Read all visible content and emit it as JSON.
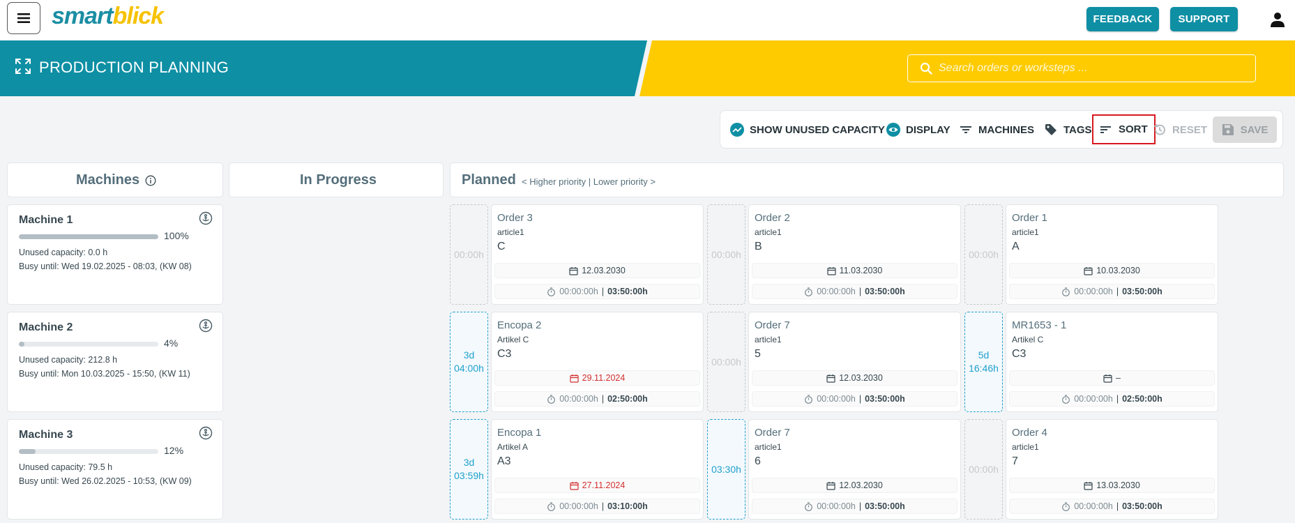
{
  "brand": {
    "logo_part1": "smart",
    "logo_part2": "blick"
  },
  "topnav": {
    "feedback": "FEEDBACK",
    "support": "SUPPORT"
  },
  "banner": {
    "title": "PRODUCTION PLANNING",
    "search_placeholder": "Search orders or worksteps ..."
  },
  "toolbar": {
    "unused": "SHOW UNUSED CAPACITY",
    "display": "DISPLAY",
    "machines": "MACHINES",
    "tags": "TAGS",
    "sort": "SORT",
    "reset": "RESET",
    "save": "SAVE"
  },
  "columns": {
    "machines": "Machines",
    "inprogress": "In Progress",
    "planned": "Planned",
    "planned_hint": "< Higher priority | Lower priority >"
  },
  "colors": {
    "teal": "#0e8fa4",
    "yellow": "#fecb00",
    "gap_active": "#1fa1cc",
    "late": "#d32f2f"
  },
  "machines": [
    {
      "name": "Machine 1",
      "load_fraction": 1.0,
      "pct": "100%",
      "unused": "Unused capacity: 0.0 h",
      "busy": "Busy until: Wed 19.02.2025 - 08:03, (KW 08)"
    },
    {
      "name": "Machine 2",
      "load_fraction": 0.04,
      "pct": "4%",
      "unused": "Unused capacity: 212.8 h",
      "busy": "Busy until: Mon 10.03.2025 - 15:50, (KW 11)"
    },
    {
      "name": "Machine 3",
      "load_fraction": 0.12,
      "pct": "12%",
      "unused": "Unused capacity: 79.5 h",
      "busy": "Busy until: Wed 26.02.2025 - 10:53, (KW 09)"
    }
  ],
  "rows": [
    {
      "gaps": [
        {
          "line1": "",
          "line2": "00:00h",
          "active": false
        },
        {
          "line1": "",
          "line2": "00:00h",
          "active": false
        },
        {
          "line1": "",
          "line2": "00:00h",
          "active": false
        }
      ],
      "orders": [
        {
          "title": "Order 3",
          "article": "article1",
          "code": "C",
          "date": "12.03.2030",
          "late": false,
          "run": "00:00:00h",
          "sep": "|",
          "dur": "03:50:00h"
        },
        {
          "title": "Order 2",
          "article": "article1",
          "code": "B",
          "date": "11.03.2030",
          "late": false,
          "run": "00:00:00h",
          "sep": "|",
          "dur": "03:50:00h"
        },
        {
          "title": "Order 1",
          "article": "article1",
          "code": "A",
          "date": "10.03.2030",
          "late": false,
          "run": "00:00:00h",
          "sep": "|",
          "dur": "03:50:00h"
        }
      ]
    },
    {
      "gaps": [
        {
          "line1": "3d",
          "line2": "04:00h",
          "active": true
        },
        {
          "line1": "",
          "line2": "00:00h",
          "active": false
        },
        {
          "line1": "5d",
          "line2": "16:46h",
          "active": true
        }
      ],
      "orders": [
        {
          "title": "Encopa 2",
          "article": "Artikel C",
          "code": "C3",
          "date": "29.11.2024",
          "late": true,
          "run": "00:00:00h",
          "sep": "|",
          "dur": "02:50:00h"
        },
        {
          "title": "Order 7",
          "article": "article1",
          "code": "5",
          "date": "12.03.2030",
          "late": false,
          "run": "00:00:00h",
          "sep": "|",
          "dur": "03:50:00h"
        },
        {
          "title": "MR1653 - 1",
          "article": "Artikel C",
          "code": "C3",
          "date": "–",
          "late": false,
          "run": "00:00:00h",
          "sep": "|",
          "dur": "02:50:00h"
        }
      ]
    },
    {
      "gaps": [
        {
          "line1": "3d",
          "line2": "03:59h",
          "active": true
        },
        {
          "line1": "",
          "line2": "03:30h",
          "active": true
        },
        {
          "line1": "",
          "line2": "00:00h",
          "active": false
        }
      ],
      "orders": [
        {
          "title": "Encopa 1",
          "article": "Artikel A",
          "code": "A3",
          "date": "27.11.2024",
          "late": true,
          "run": "00:00:00h",
          "sep": "|",
          "dur": "03:10:00h"
        },
        {
          "title": "Order 7",
          "article": "article1",
          "code": "6",
          "date": "12.03.2030",
          "late": false,
          "run": "00:00:00h",
          "sep": "|",
          "dur": "03:50:00h"
        },
        {
          "title": "Order 4",
          "article": "article1",
          "code": "7",
          "date": "13.03.2030",
          "late": false,
          "run": "00:00:00h",
          "sep": "|",
          "dur": "03:50:00h"
        }
      ]
    }
  ]
}
